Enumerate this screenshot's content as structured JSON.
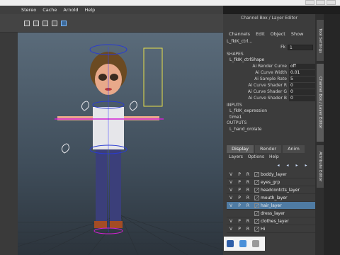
{
  "menubar": {
    "items": [
      "Stereo",
      "Cache",
      "Arnold",
      "Help"
    ]
  },
  "viewport": {
    "bottom_label": ""
  },
  "channel_box": {
    "title": "Channel Box / Layer Editor",
    "menu": [
      "Channels",
      "Edit",
      "Object",
      "Show"
    ],
    "node_name": "L_fkIK_ctrl...",
    "fk_label": "Fk",
    "fk_value": "1",
    "shapes_title": "SHAPES",
    "shape_name": "L_fkIK_ctrlShape",
    "attributes": [
      {
        "label": "Ai Render Curve",
        "value": "off"
      },
      {
        "label": "Ai Curve Width",
        "value": "0.01"
      },
      {
        "label": "Ai Sample Rate",
        "value": "5"
      },
      {
        "label": "Ai Curve Shader R",
        "value": "0"
      },
      {
        "label": "Ai Curve Shader G",
        "value": "0"
      },
      {
        "label": "Ai Curve Shader B",
        "value": "0"
      }
    ],
    "inputs_title": "INPUTS",
    "inputs": [
      "L_fkIK_expression",
      "time1"
    ],
    "outputs_title": "OUTPUTS",
    "outputs": [
      "L_hand_orolate"
    ]
  },
  "right_tabs": [
    "Tool Settings",
    "Channel Box / Layer Editor",
    "Attribute Editor"
  ],
  "layer_editor": {
    "tabs": [
      "Display",
      "Render",
      "Anim"
    ],
    "menu": [
      "Layers",
      "Options",
      "Help"
    ],
    "layers": [
      {
        "v": "V",
        "p": "P",
        "r": "R",
        "name": "boddy_layer",
        "selected": false
      },
      {
        "v": "V",
        "p": "P",
        "r": "R",
        "name": "eyes_grp",
        "selected": false
      },
      {
        "v": "V",
        "p": "P",
        "r": "R",
        "name": "headcontcts_layer",
        "selected": false
      },
      {
        "v": "V",
        "p": "P",
        "r": "R",
        "name": "mouth_layer",
        "selected": false
      },
      {
        "v": "V",
        "p": "P",
        "r": "R",
        "name": "hair_layer",
        "selected": true
      },
      {
        "v": "",
        "p": "",
        "r": "",
        "name": "dress_layer",
        "selected": false
      },
      {
        "v": "V",
        "p": "P",
        "r": "R",
        "name": "clothes_layer",
        "selected": false
      },
      {
        "v": "V",
        "p": "P",
        "r": "R",
        "name": "Hi",
        "selected": false
      }
    ]
  },
  "colors": {
    "accent_selected": "#4f7ba3",
    "panel": "#3c3c3c",
    "viewport_top": "#5a6b7a",
    "control_curve_blue": "#2a3bd1",
    "control_curve_magenta": "#d320d3",
    "control_curve_yellow": "#e8e04a"
  }
}
